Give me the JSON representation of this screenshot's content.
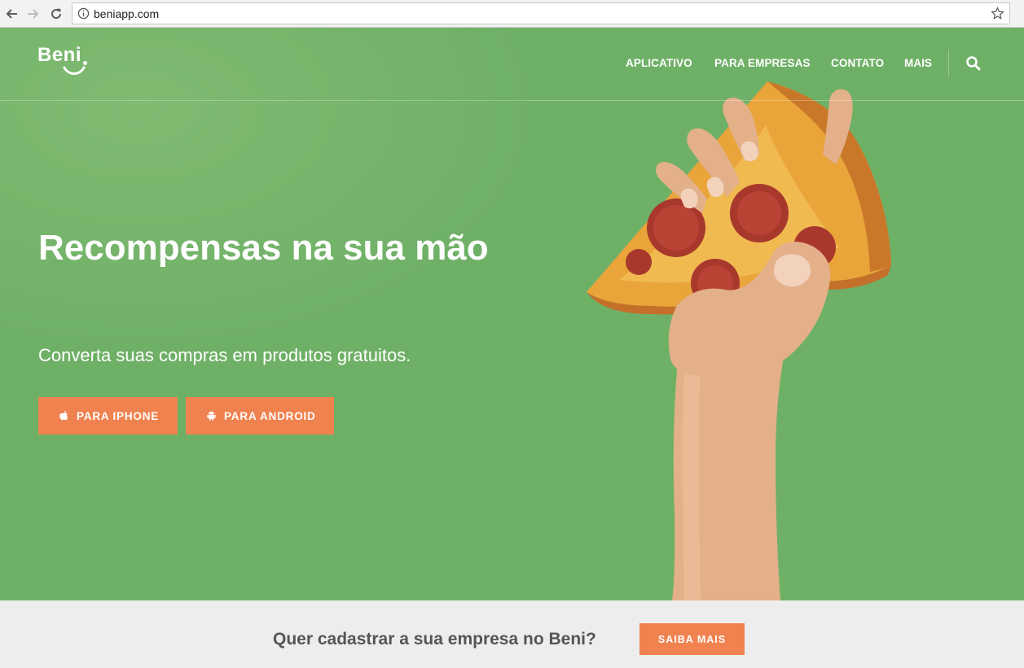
{
  "browser": {
    "url": "beniapp.com"
  },
  "site": {
    "logo_text": "Beni",
    "nav": {
      "aplicativo": "APLICATIVO",
      "para_empresas": "PARA EMPRESAS",
      "contato": "CONTATO",
      "mais": "MAIS"
    }
  },
  "hero": {
    "title": "Recompensas na sua mão",
    "subtitle": "Converta suas compras em produtos gratuitos.",
    "buttons": {
      "iphone": "PARA IPHONE",
      "android": "PARA ANDROID"
    }
  },
  "band": {
    "text": "Quer cadastrar a sua empresa no Beni?",
    "button": "SAIBA MAIS"
  },
  "colors": {
    "hero_green": "#6fb067",
    "accent_orange": "#f0824f",
    "band_gray": "#ededed",
    "band_text": "#555555"
  },
  "icons": {
    "back": "back-arrow-icon",
    "forward": "forward-arrow-icon",
    "reload": "reload-icon",
    "info": "info-icon",
    "bookmark": "star-icon",
    "search": "search-icon",
    "apple": "apple-icon",
    "android": "android-icon"
  }
}
